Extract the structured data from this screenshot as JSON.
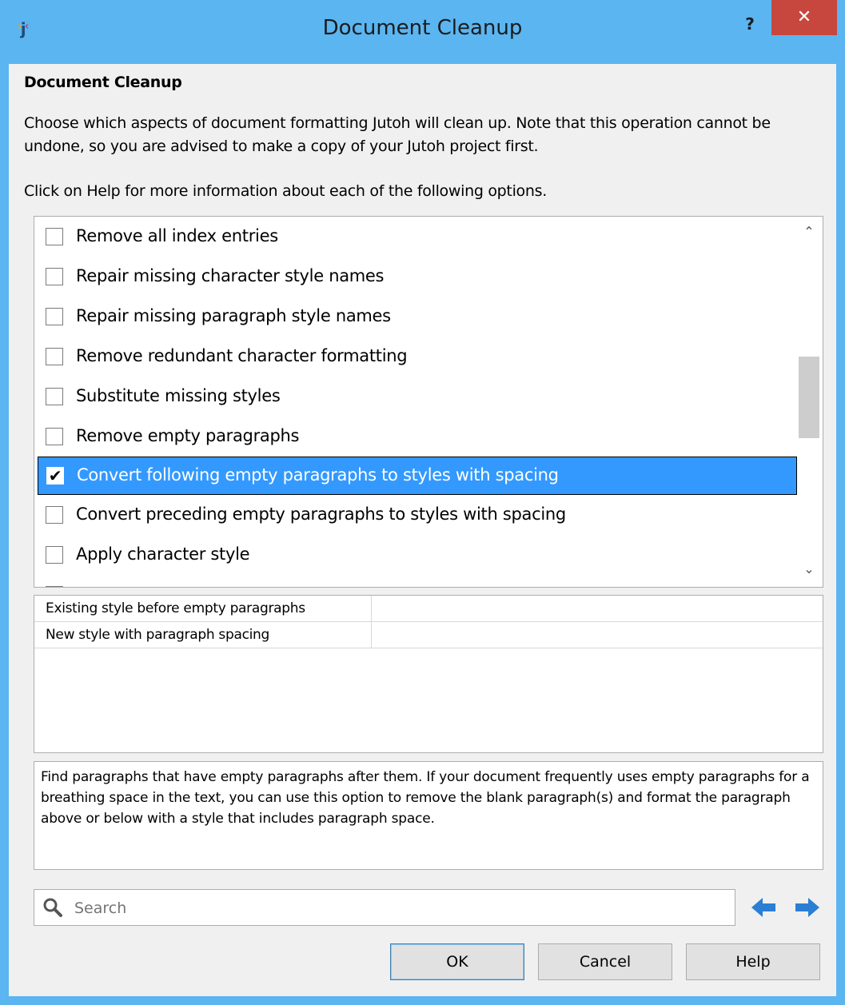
{
  "window": {
    "title": "Document Cleanup",
    "help_label": "?",
    "close_label": "✕"
  },
  "dialog": {
    "heading": "Document Cleanup",
    "description": "Choose which aspects of document formatting Jutoh will clean up. Note that this operation cannot be undone, so you are advised to make a copy of your Jutoh project first.",
    "hint": "Click on Help for more information about each of the following options."
  },
  "options": [
    {
      "label": "Remove all index entries",
      "checked": false
    },
    {
      "label": "Repair missing character style names",
      "checked": false
    },
    {
      "label": "Repair missing paragraph style names",
      "checked": false
    },
    {
      "label": "Remove redundant character formatting",
      "checked": false
    },
    {
      "label": "Substitute missing styles",
      "checked": false
    },
    {
      "label": "Remove empty paragraphs",
      "checked": false
    },
    {
      "label": "Convert following empty paragraphs to styles with spacing",
      "checked": true
    },
    {
      "label": "Convert preceding empty paragraphs to styles with spacing",
      "checked": false
    },
    {
      "label": "Apply character style",
      "checked": false
    }
  ],
  "properties": [
    {
      "name": "Existing style before empty paragraphs",
      "value": ""
    },
    {
      "name": "New style with paragraph spacing",
      "value": ""
    }
  ],
  "info_text": "Find paragraphs that have empty paragraphs after them. If your document frequently uses empty paragraphs for a breathing space in the text, you can use this option to remove the blank paragraph(s) and format the paragraph above or below with a style that includes paragraph space.",
  "search": {
    "placeholder": "Search",
    "value": ""
  },
  "buttons": {
    "ok": "OK",
    "cancel": "Cancel",
    "help": "Help"
  },
  "icons": {
    "app": "jutoh-app-icon",
    "search": "search-icon",
    "prev": "arrow-left-icon",
    "next": "arrow-right-icon",
    "scroll_up": "chevron-up-icon",
    "scroll_down": "chevron-down-icon"
  },
  "colors": {
    "titlebar": "#5bb5f0",
    "close_button": "#c7463e",
    "selection": "#3399ff",
    "nav_arrow": "#2a7fd4"
  }
}
